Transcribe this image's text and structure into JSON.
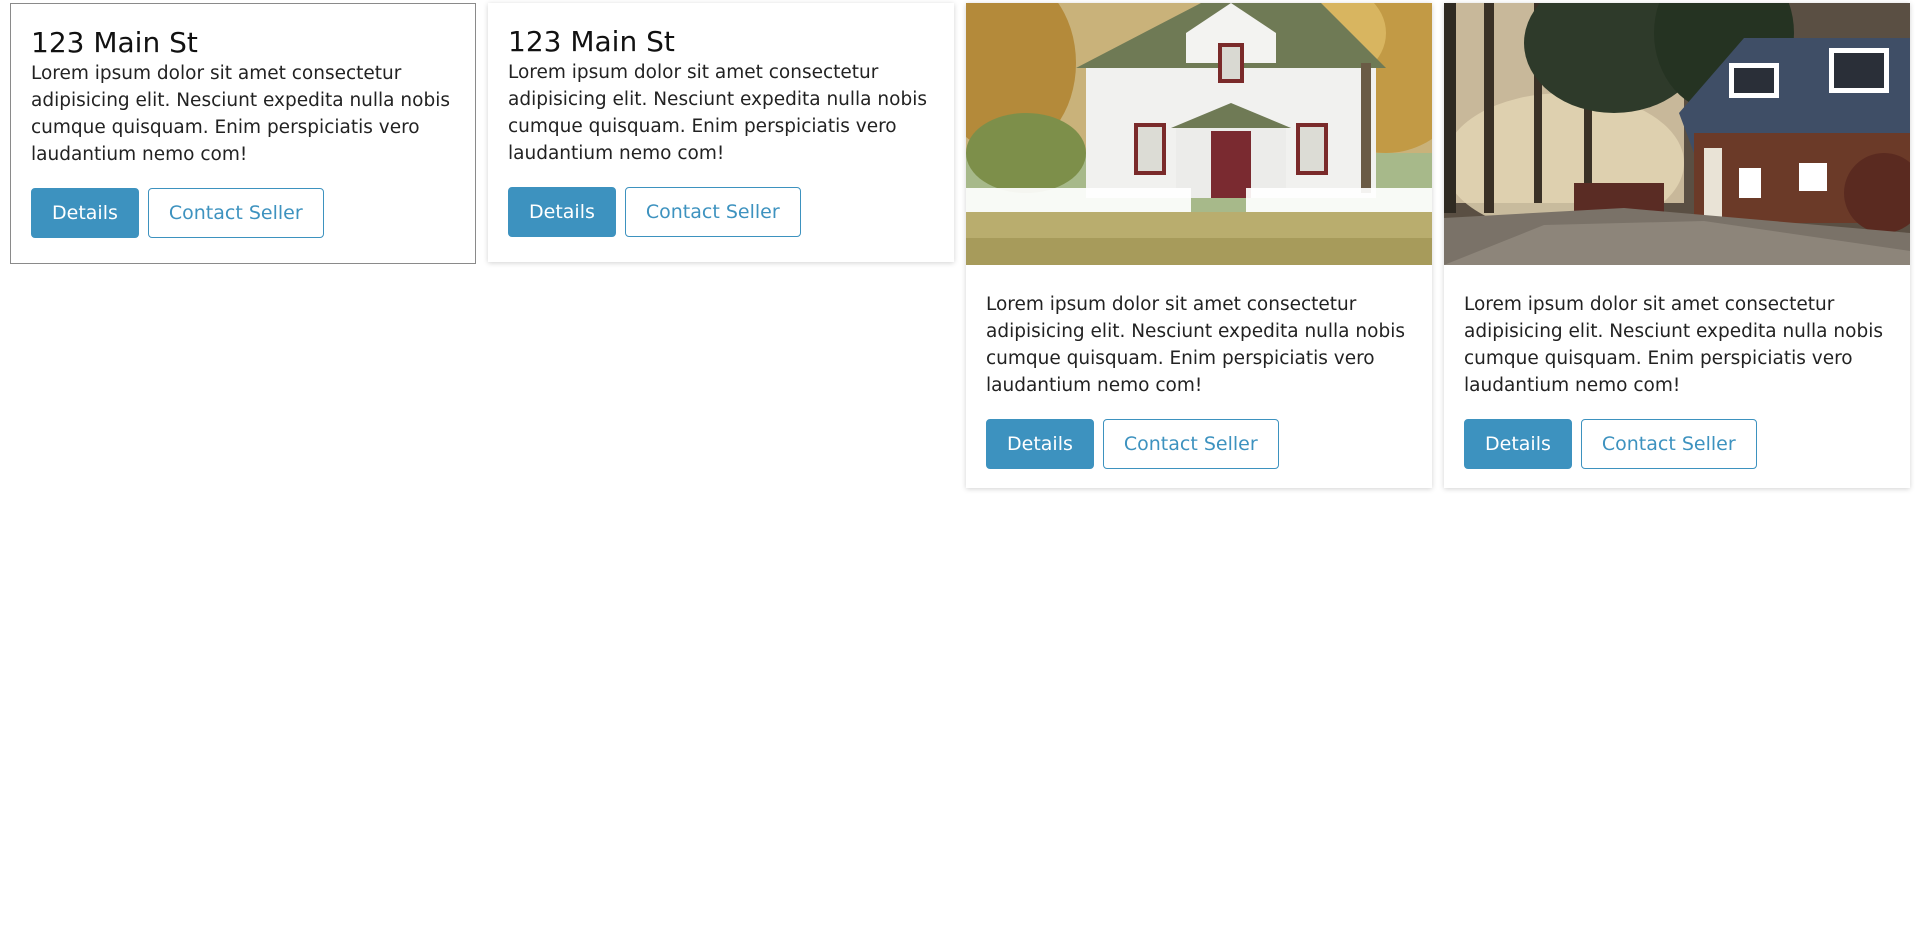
{
  "cards": [
    {
      "title": "123 Main St",
      "text": "Lorem ipsum dolor sit amet consectetur adipisicing elit. Nesciunt expedita nulla nobis cumque quisquam. Enim perspiciatis vero laudantium nemo com!",
      "details_label": "Details",
      "contact_label": "Contact Seller"
    },
    {
      "title": "123 Main St",
      "text": "Lorem ipsum dolor sit amet consectetur adipisicing elit. Nesciunt expedita nulla nobis cumque quisquam. Enim perspiciatis vero laudantium nemo com!",
      "details_label": "Details",
      "contact_label": "Contact Seller"
    },
    {
      "image": "white-house-photo",
      "text": "Lorem ipsum dolor sit amet consectetur adipisicing elit. Nesciunt expedita nulla nobis cumque quisquam. Enim perspiciatis vero laudantium nemo com!",
      "details_label": "Details",
      "contact_label": "Contact Seller"
    },
    {
      "image": "brown-house-photo",
      "text": "Lorem ipsum dolor sit amet consectetur adipisicing elit. Nesciunt expedita nulla nobis cumque quisquam. Enim perspiciatis vero laudantium nemo com!",
      "details_label": "Details",
      "contact_label": "Contact Seller"
    }
  ],
  "colors": {
    "accent": "#3d92bf",
    "card_border": "#8a8a8a",
    "text": "#222222"
  }
}
